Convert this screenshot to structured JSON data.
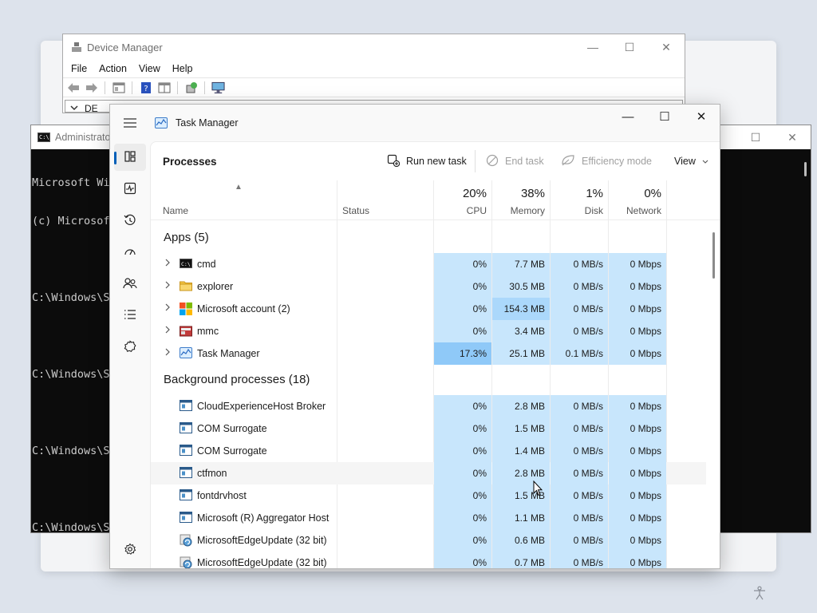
{
  "device_manager": {
    "title": "Device Manager",
    "menu": [
      "File",
      "Action",
      "View",
      "Help"
    ],
    "tree_root": "DE"
  },
  "cmd": {
    "title": "Administrato",
    "lines": [
      "Microsoft Wi",
      "(c) Microsof",
      "",
      "C:\\Windows\\Sy",
      "",
      "C:\\Windows\\Sy",
      "",
      "C:\\Windows\\Sy",
      "",
      "C:\\Windows\\Sy"
    ]
  },
  "task_manager": {
    "title": "Task Manager",
    "page_title": "Processes",
    "commands": {
      "run_new_task": "Run new task",
      "end_task": "End task",
      "efficiency_mode": "Efficiency mode",
      "view": "View"
    },
    "columns": {
      "name": "Name",
      "status": "Status",
      "cpu": {
        "label": "CPU",
        "pct": "20%"
      },
      "memory": {
        "label": "Memory",
        "pct": "38%"
      },
      "disk": {
        "label": "Disk",
        "pct": "1%"
      },
      "network": {
        "label": "Network",
        "pct": "0%"
      }
    },
    "groups": [
      {
        "title": "Apps (5)",
        "rows": [
          {
            "name": "cmd",
            "icon": "cmd-icon",
            "expandable": true,
            "cpu": "0%",
            "memory": "7.7 MB",
            "disk": "0 MB/s",
            "network": "0 Mbps",
            "heat": {
              "cpu": 1,
              "memory": 1,
              "disk": 1,
              "network": 1
            }
          },
          {
            "name": "explorer",
            "icon": "folder-icon",
            "expandable": true,
            "cpu": "0%",
            "memory": "30.5 MB",
            "disk": "0 MB/s",
            "network": "0 Mbps",
            "heat": {
              "cpu": 1,
              "memory": 1,
              "disk": 1,
              "network": 1
            }
          },
          {
            "name": "Microsoft account (2)",
            "icon": "microsoft-logo-icon",
            "expandable": true,
            "cpu": "0%",
            "memory": "154.3 MB",
            "disk": "0 MB/s",
            "network": "0 Mbps",
            "heat": {
              "cpu": 1,
              "memory": 2,
              "disk": 1,
              "network": 1
            }
          },
          {
            "name": "mmc",
            "icon": "mmc-icon",
            "expandable": true,
            "cpu": "0%",
            "memory": "3.4 MB",
            "disk": "0 MB/s",
            "network": "0 Mbps",
            "heat": {
              "cpu": 1,
              "memory": 1,
              "disk": 1,
              "network": 1
            }
          },
          {
            "name": "Task Manager",
            "icon": "task-manager-icon",
            "expandable": true,
            "cpu": "17.3%",
            "memory": "25.1 MB",
            "disk": "0.1 MB/s",
            "network": "0 Mbps",
            "heat": {
              "cpu": 3,
              "memory": 1,
              "disk": 1,
              "network": 1
            }
          }
        ]
      },
      {
        "title": "Background processes (18)",
        "rows": [
          {
            "name": "CloudExperienceHost Broker",
            "icon": "process-icon",
            "expandable": false,
            "cpu": "0%",
            "memory": "2.8 MB",
            "disk": "0 MB/s",
            "network": "0 Mbps",
            "heat": {
              "cpu": 1,
              "memory": 1,
              "disk": 1,
              "network": 1
            }
          },
          {
            "name": "COM Surrogate",
            "icon": "process-icon",
            "expandable": false,
            "cpu": "0%",
            "memory": "1.5 MB",
            "disk": "0 MB/s",
            "network": "0 Mbps",
            "heat": {
              "cpu": 1,
              "memory": 1,
              "disk": 1,
              "network": 1
            }
          },
          {
            "name": "COM Surrogate",
            "icon": "process-icon",
            "expandable": false,
            "cpu": "0%",
            "memory": "1.4 MB",
            "disk": "0 MB/s",
            "network": "0 Mbps",
            "heat": {
              "cpu": 1,
              "memory": 1,
              "disk": 1,
              "network": 1
            }
          },
          {
            "name": "ctfmon",
            "icon": "process-icon",
            "expandable": false,
            "cpu": "0%",
            "memory": "2.8 MB",
            "disk": "0 MB/s",
            "network": "0 Mbps",
            "heat": {
              "cpu": 1,
              "memory": 1,
              "disk": 1,
              "network": 1
            },
            "hover": true
          },
          {
            "name": "fontdrvhost",
            "icon": "process-icon",
            "expandable": false,
            "cpu": "0%",
            "memory": "1.5 MB",
            "disk": "0 MB/s",
            "network": "0 Mbps",
            "heat": {
              "cpu": 1,
              "memory": 1,
              "disk": 1,
              "network": 1
            }
          },
          {
            "name": "Microsoft (R) Aggregator Host",
            "icon": "process-icon",
            "expandable": false,
            "cpu": "0%",
            "memory": "1.1 MB",
            "disk": "0 MB/s",
            "network": "0 Mbps",
            "heat": {
              "cpu": 1,
              "memory": 1,
              "disk": 1,
              "network": 1
            }
          },
          {
            "name": "MicrosoftEdgeUpdate (32 bit)",
            "icon": "edge-update-icon",
            "expandable": false,
            "cpu": "0%",
            "memory": "0.6 MB",
            "disk": "0 MB/s",
            "network": "0 Mbps",
            "heat": {
              "cpu": 1,
              "memory": 1,
              "disk": 1,
              "network": 1
            }
          },
          {
            "name": "MicrosoftEdgeUpdate (32 bit)",
            "icon": "edge-update-icon",
            "expandable": false,
            "cpu": "0%",
            "memory": "0.7 MB",
            "disk": "0 MB/s",
            "network": "0 Mbps",
            "heat": {
              "cpu": 1,
              "memory": 1,
              "disk": 1,
              "network": 1
            }
          }
        ]
      }
    ],
    "nav": [
      "hamburger-menu-icon",
      "processes-icon",
      "performance-icon",
      "app-history-icon",
      "startup-apps-icon",
      "users-icon",
      "details-icon",
      "services-icon",
      "settings-icon"
    ]
  },
  "colors": {
    "accent": "#005fb8",
    "heat_low": "#c8e6fc",
    "heat_mid": "#abd8fb",
    "heat_high": "#8fc9f8"
  }
}
